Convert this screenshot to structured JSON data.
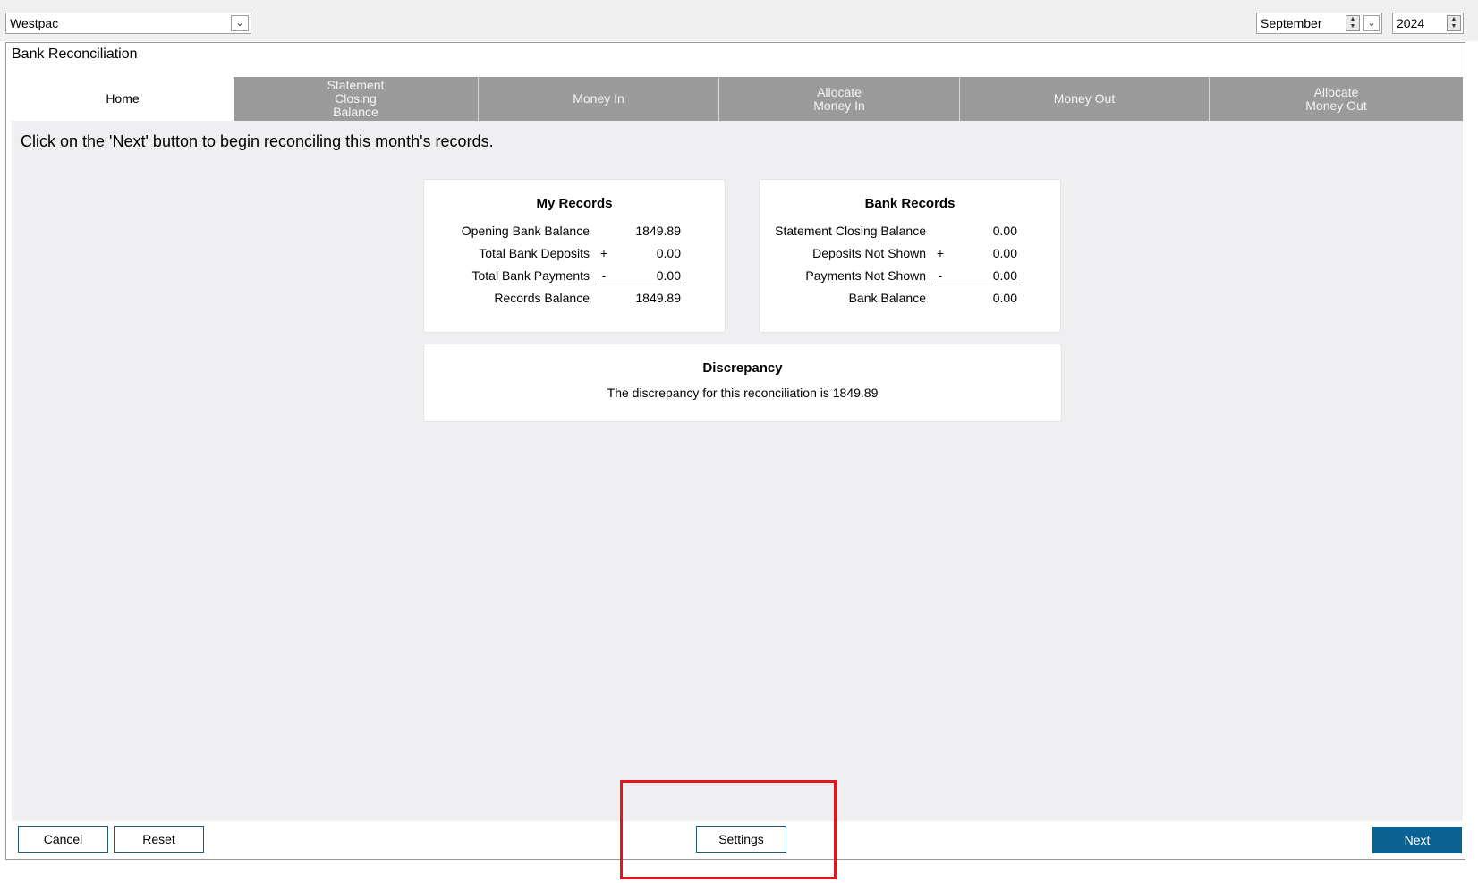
{
  "bank_select": {
    "value": "Westpac"
  },
  "period": {
    "month": "September",
    "year": "2024"
  },
  "window": {
    "title": "Bank Reconciliation"
  },
  "tabs": [
    {
      "label": "Home"
    },
    {
      "label": "Statement\nClosing\nBalance"
    },
    {
      "label": "Money In"
    },
    {
      "label": "Allocate\nMoney In"
    },
    {
      "label": "Money Out"
    },
    {
      "label": "Allocate\nMoney Out"
    }
  ],
  "instruction": "Click on the 'Next' button to begin reconciling this month's records.",
  "my_records": {
    "title": "My Records",
    "rows": [
      {
        "label": "Opening Bank Balance",
        "sign": "",
        "value": "1849.89"
      },
      {
        "label": "Total Bank Deposits",
        "sign": "+",
        "value": "0.00"
      },
      {
        "label": "Total Bank Payments",
        "sign": "-",
        "value": "0.00"
      },
      {
        "label": "Records Balance",
        "sign": "",
        "value": "1849.89"
      }
    ]
  },
  "bank_records": {
    "title": "Bank Records",
    "rows": [
      {
        "label": "Statement Closing Balance",
        "sign": "",
        "value": "0.00"
      },
      {
        "label": "Deposits Not Shown",
        "sign": "+",
        "value": "0.00"
      },
      {
        "label": "Payments Not Shown",
        "sign": "-",
        "value": "0.00"
      },
      {
        "label": "Bank Balance",
        "sign": "",
        "value": "0.00"
      }
    ]
  },
  "discrepancy": {
    "title": "Discrepancy",
    "text": "The discrepancy for this reconciliation is 1849.89"
  },
  "buttons": {
    "cancel": "Cancel",
    "reset": "Reset",
    "settings": "Settings",
    "next": "Next"
  },
  "colors": {
    "tab_inactive": "#9b9b9b",
    "next_button": "#0b6193",
    "highlight": "#e0161c"
  }
}
